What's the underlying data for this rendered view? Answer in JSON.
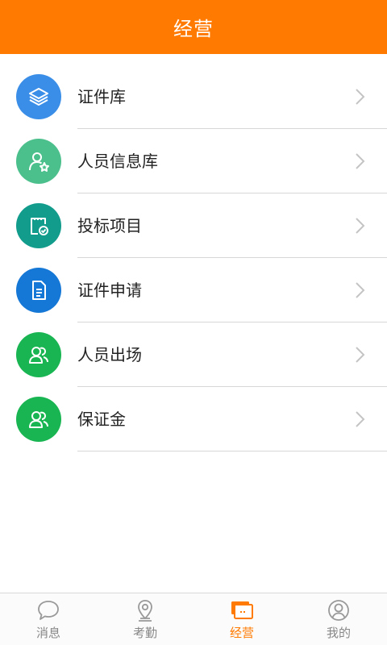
{
  "header": {
    "title": "经营"
  },
  "colors": {
    "accent": "#ff7a00",
    "item_icons": [
      "#3a8ee8",
      "#4cc08c",
      "#129c8c",
      "#1578d6",
      "#19b552",
      "#19b552"
    ]
  },
  "items": [
    {
      "label": "证件库",
      "icon": "layers-icon"
    },
    {
      "label": "人员信息库",
      "icon": "person-star-icon"
    },
    {
      "label": "投标项目",
      "icon": "clipboard-check-icon"
    },
    {
      "label": "证件申请",
      "icon": "document-icon"
    },
    {
      "label": "人员出场",
      "icon": "people-icon"
    },
    {
      "label": "保证金",
      "icon": "people-icon"
    }
  ],
  "tabs": [
    {
      "label": "消息",
      "icon": "chat-bubble-icon",
      "active": false
    },
    {
      "label": "考勤",
      "icon": "location-pin-icon",
      "active": false
    },
    {
      "label": "经营",
      "icon": "business-card-icon",
      "active": true
    },
    {
      "label": "我的",
      "icon": "user-circle-icon",
      "active": false
    }
  ]
}
